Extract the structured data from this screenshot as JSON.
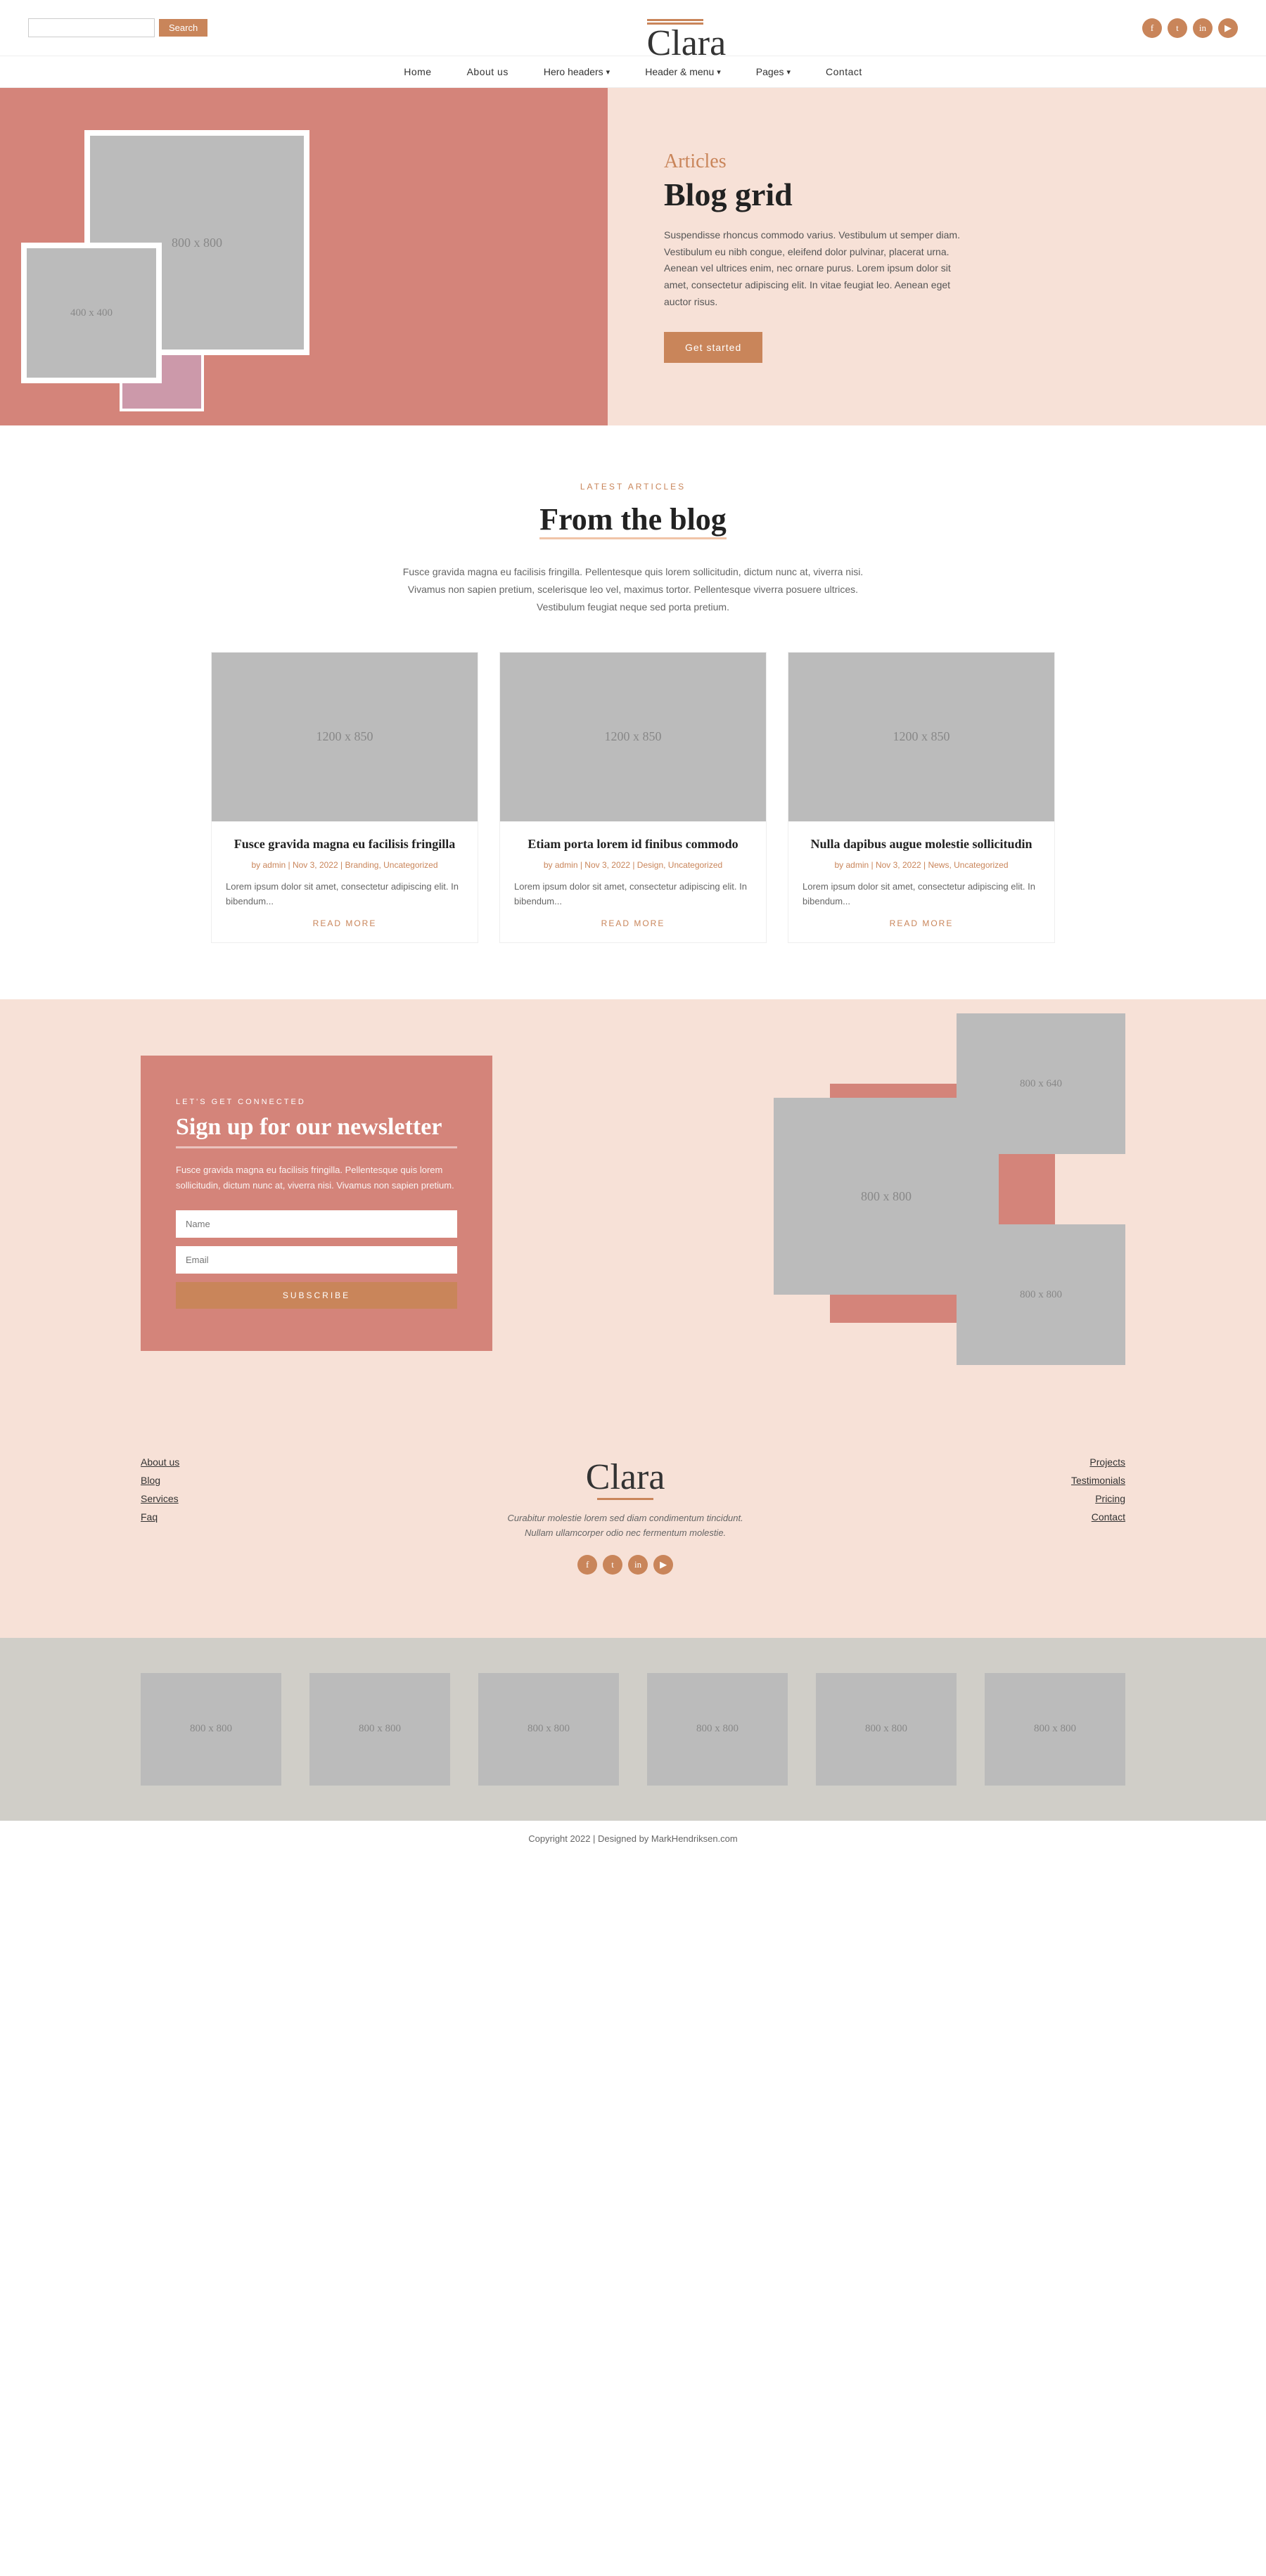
{
  "header": {
    "search_placeholder": "",
    "search_button": "Search",
    "logo": "Clara",
    "social": [
      "f",
      "t",
      "in",
      "yt"
    ]
  },
  "nav": {
    "items": [
      {
        "label": "Home",
        "dropdown": false
      },
      {
        "label": "About us",
        "dropdown": false
      },
      {
        "label": "Hero headers",
        "dropdown": true
      },
      {
        "label": "Header & menu",
        "dropdown": true
      },
      {
        "label": "Pages",
        "dropdown": true
      },
      {
        "label": "Contact",
        "dropdown": false
      }
    ]
  },
  "hero": {
    "img_large": "800 x 800",
    "img_small": "400 x 400",
    "subtitle": "Articles",
    "title": "Blog grid",
    "text": "Suspendisse rhoncus commodo varius. Vestibulum ut semper diam. Vestibulum eu nibh congue, eleifend dolor pulvinar, placerat urna. Aenean vel ultrices enim, nec ornare purus. Lorem ipsum dolor sit amet, consectetur adipiscing elit. In vitae feugiat leo. Aenean eget auctor risus.",
    "button": "Get started"
  },
  "blog": {
    "tag": "LATEST ARTICLES",
    "title": "From the blog",
    "desc": "Fusce gravida magna eu facilisis fringilla. Pellentesque quis lorem sollicitudin, dictum nunc at, viverra nisi. Vivamus non sapien pretium, scelerisque leo vel, maximus tortor. Pellentesque viverra posuere ultrices. Vestibulum feugiat neque sed porta pretium.",
    "cards": [
      {
        "img": "1200 x 850",
        "title": "Fusce gravida magna eu facilisis fringilla",
        "meta": "by admin | Nov 3, 2022 | Branding, Uncategorized",
        "text": "Lorem ipsum dolor sit amet, consectetur adipiscing elit. In bibendum...",
        "link": "READ MORE"
      },
      {
        "img": "1200 x 850",
        "title": "Etiam porta lorem id finibus commodo",
        "meta": "by admin | Nov 3, 2022 | Design, Uncategorized",
        "text": "Lorem ipsum dolor sit amet, consectetur adipiscing elit. In bibendum...",
        "link": "READ MORE"
      },
      {
        "img": "1200 x 850",
        "title": "Nulla dapibus augue molestie sollicitudin",
        "meta": "by admin | Nov 3, 2022 | News, Uncategorized",
        "text": "Lorem ipsum dolor sit amet, consectetur adipiscing elit. In bibendum...",
        "link": "READ MORE"
      }
    ]
  },
  "newsletter": {
    "tag": "LET'S GET CONNECTED",
    "title": "Sign up for our newsletter",
    "text": "Fusce gravida magna eu facilisis fringilla. Pellentesque quis lorem sollicitudin, dictum nunc at, viverra nisi. Vivamus non sapien pretium.",
    "name_placeholder": "Name",
    "email_placeholder": "Email",
    "button": "SUBSCRIBE",
    "img1": "800 x 640",
    "img2": "800 x 800",
    "img3": "800 x 800"
  },
  "footer": {
    "logo": "Clara",
    "tagline": "Curabitur molestie lorem sed diam condimentum tincidunt. Nullam ullamcorper odio nec fermentum molestie.",
    "left_links": [
      {
        "label": "About us"
      },
      {
        "label": "Blog"
      },
      {
        "label": "Services"
      },
      {
        "label": "Faq"
      }
    ],
    "right_links": [
      {
        "label": "Projects"
      },
      {
        "label": "Testimonials"
      },
      {
        "label": "Pricing"
      },
      {
        "label": "Contact"
      }
    ],
    "social": [
      "f",
      "t",
      "in",
      "yt"
    ],
    "thumbs": [
      "800 x 800",
      "800 x 800",
      "800 x 800",
      "800 x 800",
      "800 x 800",
      "800 x 800"
    ],
    "copyright": "Copyright 2022 | Designed by MarkHendriksen.com"
  }
}
